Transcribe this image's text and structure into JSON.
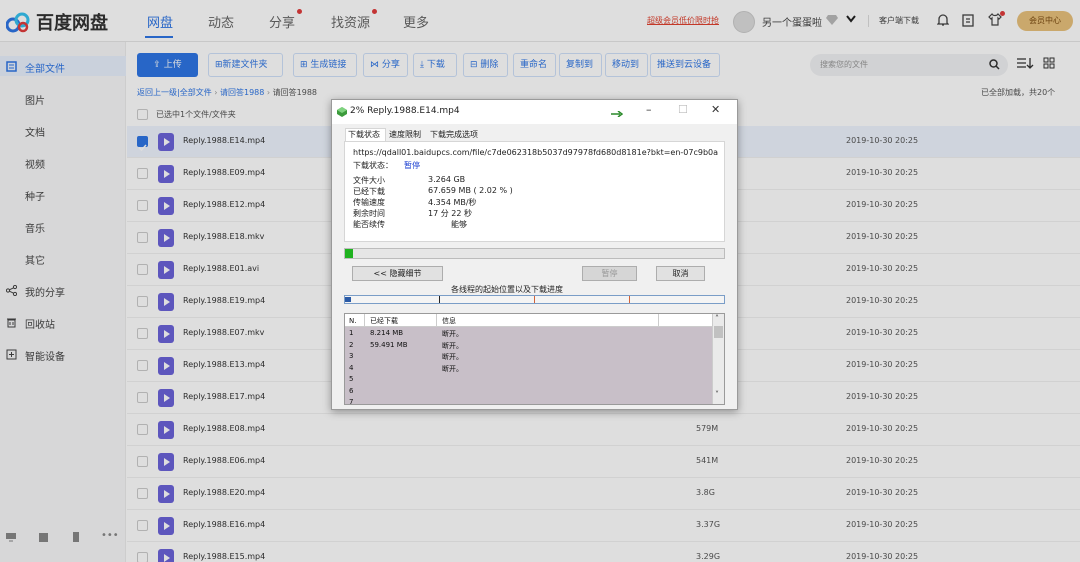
{
  "app": {
    "name": "百度网盘"
  },
  "nav": {
    "items": [
      "网盘",
      "动态",
      "分享",
      "找资源",
      "更多"
    ],
    "active": "网盘"
  },
  "header": {
    "promo": "超级会员低价限时抢",
    "username": "另一个蛋蛋啦",
    "client": "客户端下载",
    "vip": "会员中心"
  },
  "sidebar": {
    "items": [
      "全部文件",
      "图片",
      "文档",
      "视频",
      "种子",
      "音乐",
      "其它",
      "我的分享",
      "回收站",
      "智能设备"
    ]
  },
  "toolbar": {
    "upload": "上传",
    "buttons": [
      "新建文件夹",
      "生成链接",
      "分享",
      "下载",
      "删除",
      "重命名",
      "复制到",
      "移动到",
      "推送到云设备"
    ],
    "search_placeholder": "搜索您的文件"
  },
  "breadcrumb": {
    "back": "返回上一级",
    "all": "全部文件",
    "parent": "请回答1988",
    "current": "请回答1988"
  },
  "list": {
    "loaded": "已全部加载，共20个",
    "selection": "已选中1个文件/文件夹"
  },
  "files": [
    {
      "name": "Reply.1988.E14.mp4",
      "size": "",
      "date": "2019-10-30 20:25"
    },
    {
      "name": "Reply.1988.E09.mp4",
      "size": "",
      "date": "2019-10-30 20:25"
    },
    {
      "name": "Reply.1988.E12.mp4",
      "size": "",
      "date": "2019-10-30 20:25"
    },
    {
      "name": "Reply.1988.E18.mkv",
      "size": "",
      "date": "2019-10-30 20:25"
    },
    {
      "name": "Reply.1988.E01.avi",
      "size": "",
      "date": "2019-10-30 20:25"
    },
    {
      "name": "Reply.1988.E19.mp4",
      "size": "",
      "date": "2019-10-30 20:25"
    },
    {
      "name": "Reply.1988.E07.mkv",
      "size": "",
      "date": "2019-10-30 20:25"
    },
    {
      "name": "Reply.1988.E13.mp4",
      "size": "",
      "date": "2019-10-30 20:25"
    },
    {
      "name": "Reply.1988.E17.mp4",
      "size": "",
      "date": "2019-10-30 20:25"
    },
    {
      "name": "Reply.1988.E08.mp4",
      "size": "579M",
      "date": "2019-10-30 20:25"
    },
    {
      "name": "Reply.1988.E06.mp4",
      "size": "541M",
      "date": "2019-10-30 20:25"
    },
    {
      "name": "Reply.1988.E20.mp4",
      "size": "3.8G",
      "date": "2019-10-30 20:25"
    },
    {
      "name": "Reply.1988.E16.mp4",
      "size": "3.37G",
      "date": "2019-10-30 20:25"
    },
    {
      "name": "Reply.1988.E15.mp4",
      "size": "3.29G",
      "date": "2019-10-30 20:25"
    }
  ],
  "dialog": {
    "title": "2% Reply.1988.E14.mp4",
    "tabs": [
      "下载状态",
      "速度限制",
      "下载完成选项"
    ],
    "url": "https://qdall01.baidupcs.com/file/c7de062318b5037d97978fd680d8181e?bkt=en-07c9b0a504a37",
    "status_label": "下载状态：",
    "status": "暂停",
    "rows": [
      {
        "label": "文件大小",
        "value": "3.264  GB"
      },
      {
        "label": "已经下载",
        "value": "67.659  MB  ( 2.02 % )"
      },
      {
        "label": "传输速度",
        "value": "4.354  MB/秒"
      },
      {
        "label": "剩余时间",
        "value": "17 分 22 秒"
      },
      {
        "label": "能否续传",
        "value": "能够"
      }
    ],
    "progress": 0.0202,
    "hide_details": "<< 隐藏细节",
    "pause": "暂停",
    "cancel": "取消",
    "threads_caption": "各线程的起始位置以及下载进度",
    "table_headers": [
      "N.",
      "已经下载",
      "信息"
    ],
    "table_rows": [
      {
        "n": "1",
        "downloaded": "8.214  MB",
        "info": "断开。"
      },
      {
        "n": "2",
        "downloaded": "59.491  MB",
        "info": "断开。"
      },
      {
        "n": "3",
        "downloaded": "",
        "info": "断开。"
      },
      {
        "n": "4",
        "downloaded": "",
        "info": "断开。"
      },
      {
        "n": "5",
        "downloaded": "",
        "info": ""
      },
      {
        "n": "6",
        "downloaded": "",
        "info": ""
      },
      {
        "n": "7",
        "downloaded": "",
        "info": ""
      }
    ]
  },
  "colors": {
    "accent": "#2f76e5",
    "progress": "#1fb21f",
    "promo": "#e0412e",
    "vip": "#e9c27c"
  }
}
